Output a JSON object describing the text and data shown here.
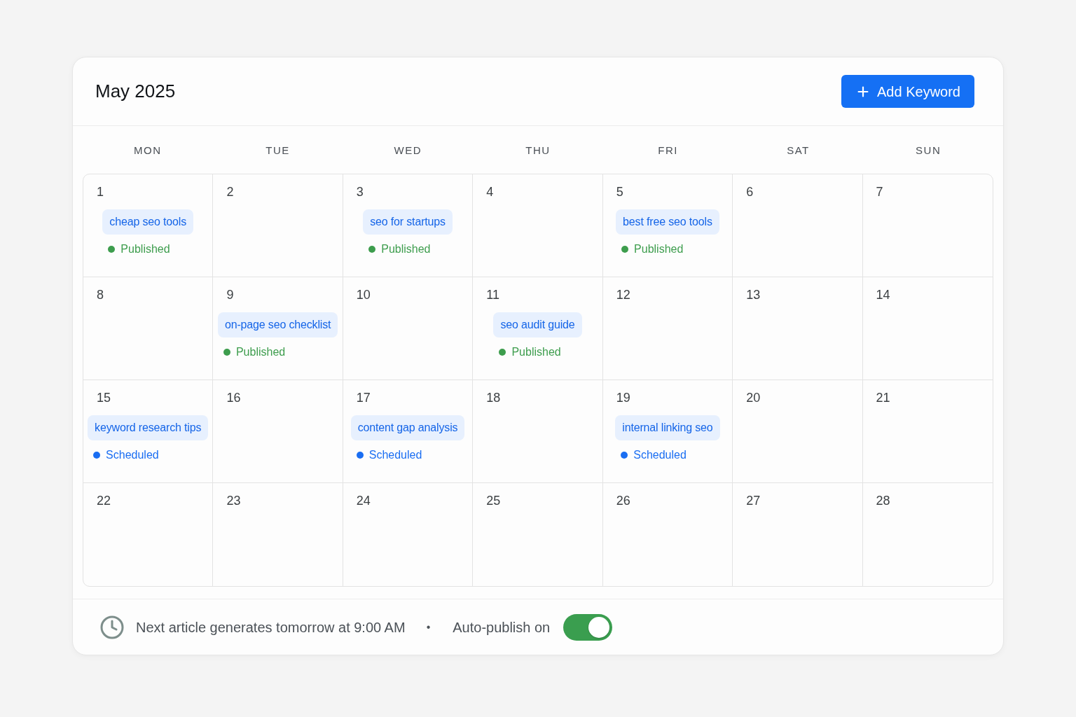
{
  "header": {
    "title": "May 2025",
    "add_button": {
      "label": "Add Keyword"
    }
  },
  "weekdays": [
    "MON",
    "TUE",
    "WED",
    "THU",
    "FRI",
    "SAT",
    "SUN"
  ],
  "days": [
    {
      "day": "1",
      "entry": {
        "keyword": "cheap seo tools",
        "status": "Published",
        "color": "#3d9d4d"
      }
    },
    {
      "day": "2"
    },
    {
      "day": "3",
      "entry": {
        "keyword": "seo for startups",
        "status": "Published",
        "color": "#3d9d4d"
      }
    },
    {
      "day": "4"
    },
    {
      "day": "5",
      "entry": {
        "keyword": "best free seo tools",
        "status": "Published",
        "color": "#3d9d4d"
      }
    },
    {
      "day": "6"
    },
    {
      "day": "7"
    },
    {
      "day": "8"
    },
    {
      "day": "9",
      "entry": {
        "keyword": "on-page seo checklist",
        "status": "Published",
        "color": "#3d9d4d"
      }
    },
    {
      "day": "10"
    },
    {
      "day": "11",
      "entry": {
        "keyword": "seo audit guide",
        "status": "Published",
        "color": "#3d9d4d"
      }
    },
    {
      "day": "12"
    },
    {
      "day": "13"
    },
    {
      "day": "14"
    },
    {
      "day": "15",
      "entry": {
        "keyword": "keyword research tips",
        "status": "Scheduled",
        "color": "#1a6ef2"
      }
    },
    {
      "day": "16"
    },
    {
      "day": "17",
      "entry": {
        "keyword": "content gap analysis",
        "status": "Scheduled",
        "color": "#1a6ef2"
      }
    },
    {
      "day": "18"
    },
    {
      "day": "19",
      "entry": {
        "keyword": "internal linking seo",
        "status": "Scheduled",
        "color": "#1a6ef2"
      }
    },
    {
      "day": "20"
    },
    {
      "day": "21"
    },
    {
      "day": "22"
    },
    {
      "day": "23"
    },
    {
      "day": "24"
    },
    {
      "day": "25"
    },
    {
      "day": "26"
    },
    {
      "day": "27"
    },
    {
      "day": "28"
    }
  ],
  "footer": {
    "next_run": "Next article generates tomorrow at 9:00 AM",
    "separator": "•",
    "auto_publish": {
      "label": "Auto-publish on",
      "on": true
    }
  }
}
